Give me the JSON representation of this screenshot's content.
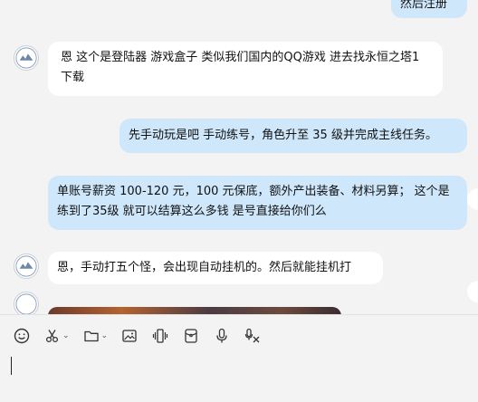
{
  "messages": [
    {
      "side": "out",
      "text": "然后注册"
    },
    {
      "side": "in",
      "text": "恩   这个是登陆器   游戏盒子  类似我们国内的QQ游戏    进去找永恒之塔1  下载"
    },
    {
      "side": "out",
      "text": "先手动玩是吧 手动练号，角色升至 35 级并完成主线任务。"
    },
    {
      "side": "out",
      "text": "单账号薪资 100-120 元，100 元保底，额外产出装备、材料另算；  这个是练到了35级  就可以结算这么多钱 是号直接给你们么"
    },
    {
      "side": "in",
      "text": "恩，手动打五个怪，会出现自动挂机的。然后就能挂机打"
    }
  ],
  "toolbar": {
    "icons": [
      "emoji-icon",
      "scissors-icon",
      "folder-icon",
      "image-icon",
      "shake-icon",
      "red-packet-icon",
      "microphone-icon",
      "voice-to-text-icon"
    ]
  },
  "composer": {
    "value": ""
  }
}
